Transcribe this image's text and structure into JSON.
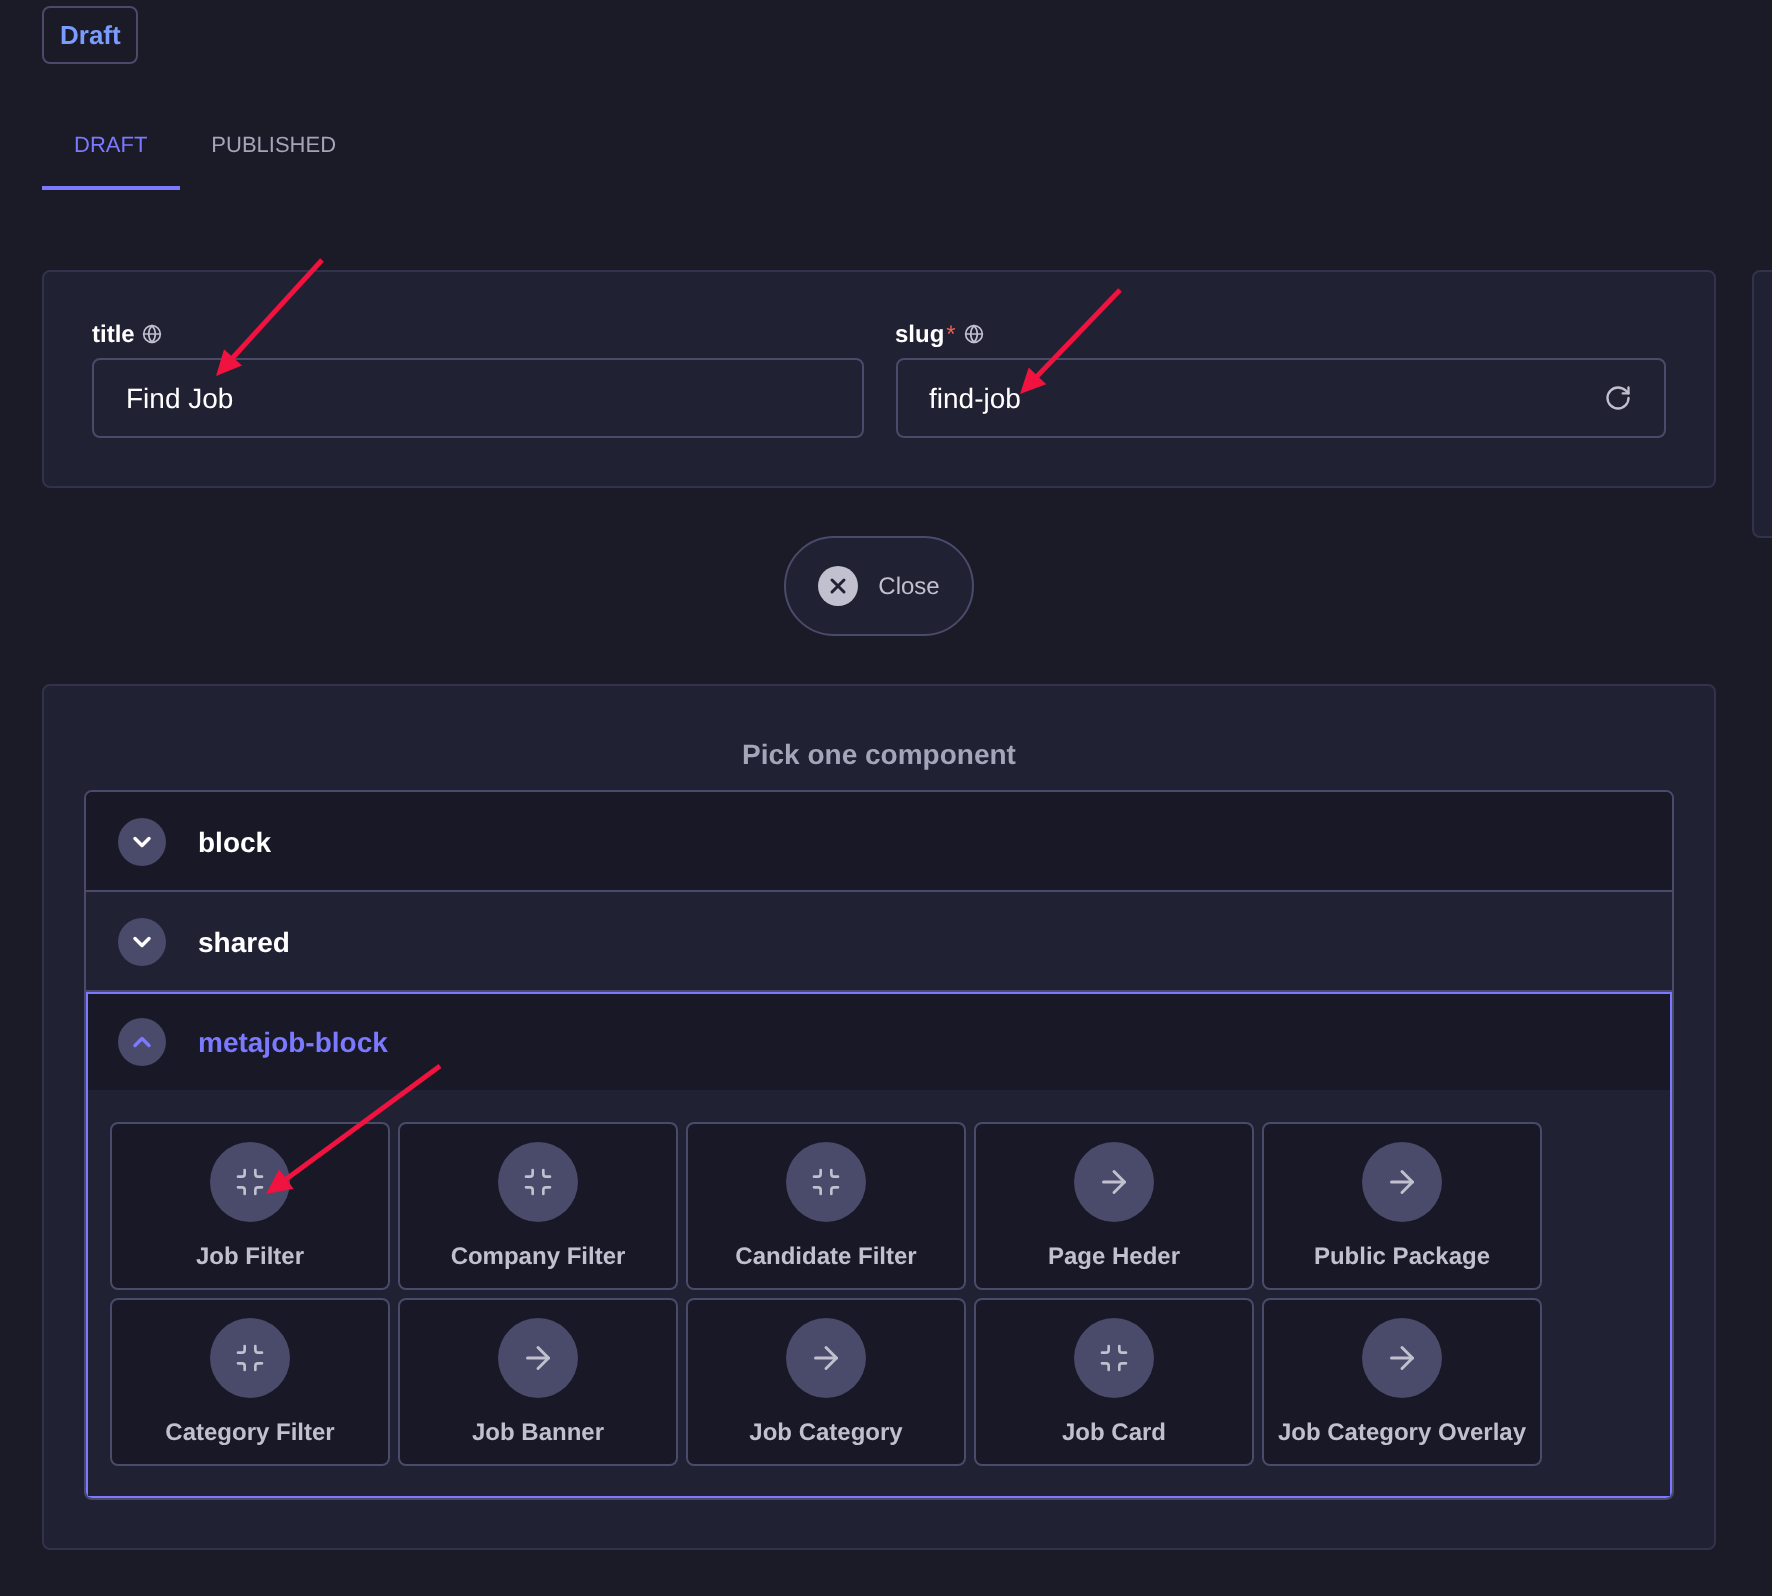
{
  "status_badge": "Draft",
  "tabs": [
    {
      "label": "DRAFT",
      "selected": true
    },
    {
      "label": "PUBLISHED",
      "selected": false
    }
  ],
  "fields": [
    {
      "label": "title",
      "value": "Find Job",
      "regenerate": false
    },
    {
      "label": "slug",
      "required_mark": "*",
      "value": "find-job",
      "regenerate": true
    }
  ],
  "close_button": "Close",
  "picker": {
    "title": "Pick one component",
    "groups": [
      {
        "name": "block",
        "expanded": false
      },
      {
        "name": "shared",
        "expanded": false
      },
      {
        "name": "metajob-block",
        "expanded": true,
        "components": [
          {
            "label": "Job Filter",
            "kind": "compress"
          },
          {
            "label": "Company Filter",
            "kind": "compress"
          },
          {
            "label": "Candidate Filter",
            "kind": "compress"
          },
          {
            "label": "Page Heder",
            "kind": "arrow"
          },
          {
            "label": "Public Package",
            "kind": "arrow"
          },
          {
            "label": "Category Filter",
            "kind": "compress"
          },
          {
            "label": "Job Banner",
            "kind": "arrow"
          },
          {
            "label": "Job Category",
            "kind": "arrow"
          },
          {
            "label": "Job Card",
            "kind": "compress"
          },
          {
            "label": "Job Category Overlay",
            "kind": "arrow"
          }
        ]
      }
    ]
  }
}
